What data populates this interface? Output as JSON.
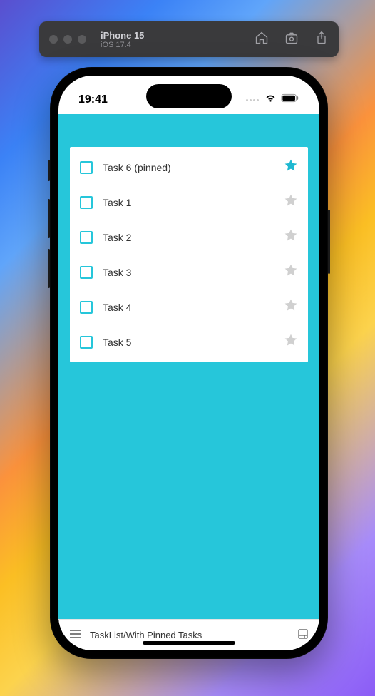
{
  "simulator": {
    "device": "iPhone 15",
    "os": "iOS 17.4"
  },
  "status": {
    "time": "19:41"
  },
  "tasks": [
    {
      "label": "Task 6 (pinned)",
      "pinned": true
    },
    {
      "label": "Task 1",
      "pinned": false
    },
    {
      "label": "Task 2",
      "pinned": false
    },
    {
      "label": "Task 3",
      "pinned": false
    },
    {
      "label": "Task 4",
      "pinned": false
    },
    {
      "label": "Task 5",
      "pinned": false
    }
  ],
  "storybook": {
    "path": "TaskList/With Pinned Tasks"
  }
}
